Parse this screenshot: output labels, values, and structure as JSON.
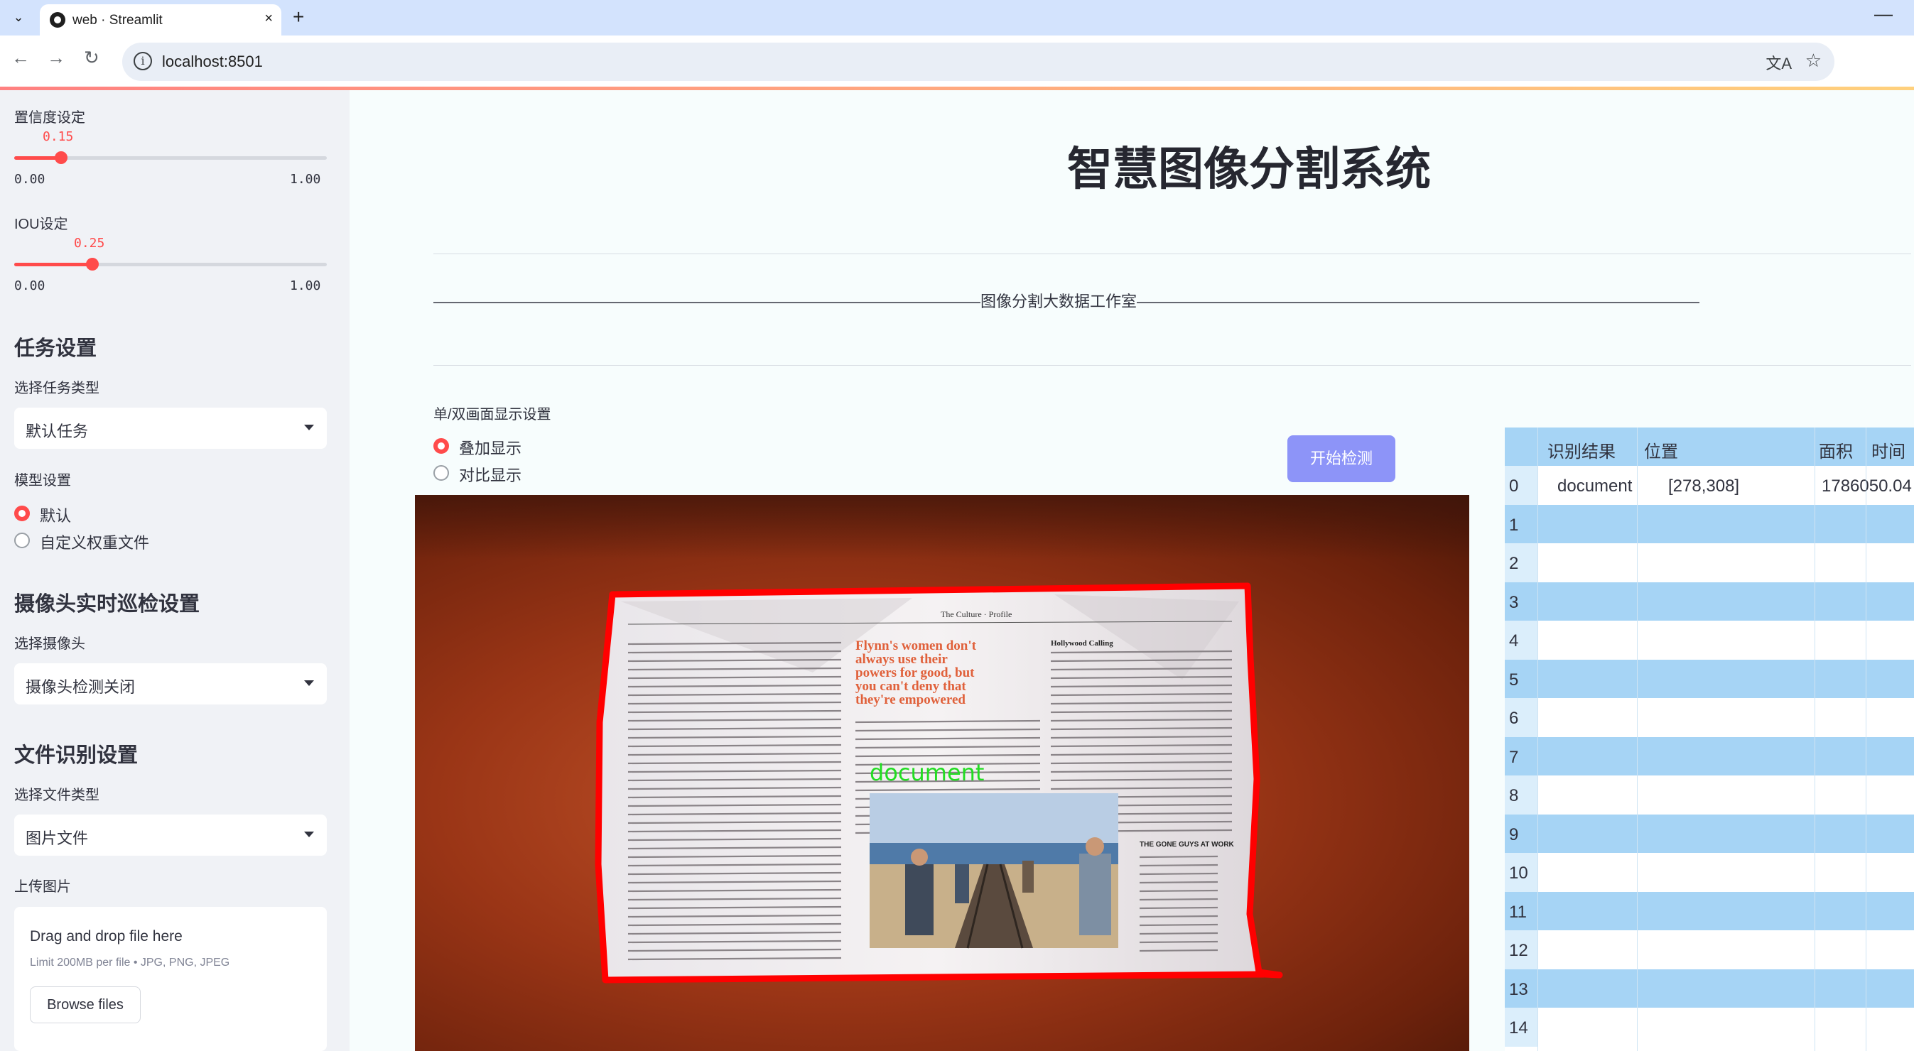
{
  "browser": {
    "tab_title": "web · Streamlit",
    "url": "localhost:8501",
    "new_tab": "+",
    "close": "×",
    "minimize": "—"
  },
  "sidebar": {
    "confidence": {
      "label": "置信度设定",
      "value": "0.15",
      "value_fraction": 0.15,
      "min": "0.00",
      "max": "1.00"
    },
    "iou": {
      "label": "IOU设定",
      "value": "0.25",
      "value_fraction": 0.25,
      "min": "0.00",
      "max": "1.00"
    },
    "task_section": {
      "heading": "任务设置",
      "select_label": "选择任务类型",
      "selected": "默认任务"
    },
    "model_section": {
      "label": "模型设置",
      "options": [
        "默认",
        "自定义权重文件"
      ],
      "selected_index": 0
    },
    "camera_section": {
      "heading": "摄像头实时巡检设置",
      "select_label": "选择摄像头",
      "selected": "摄像头检测关闭"
    },
    "file_section": {
      "heading": "文件识别设置",
      "select_label": "选择文件类型",
      "selected": "图片文件"
    },
    "upload": {
      "label": "上传图片",
      "drop_text": "Drag and drop file here",
      "limit_text": "Limit 200MB per file • JPG, PNG, JPEG",
      "browse_label": "Browse files"
    }
  },
  "main": {
    "title": "智慧图像分割系统",
    "subtitle": "———————————————————————————————————图像分割大数据工作室————————————————————————————————————",
    "display_label": "单/双画面显示设置",
    "display_options": [
      "叠加显示",
      "对比显示"
    ],
    "display_selected_index": 0,
    "start_button": "开始检测",
    "detection_label": "document"
  },
  "results_table": {
    "columns": [
      "识别结果",
      "位置",
      "面积",
      "时间"
    ],
    "rows": [
      {
        "index": "0",
        "result": "document",
        "position": "[278,308]",
        "area": "1786050.04"
      },
      {
        "index": "1"
      },
      {
        "index": "2"
      },
      {
        "index": "3"
      },
      {
        "index": "4"
      },
      {
        "index": "5"
      },
      {
        "index": "6"
      },
      {
        "index": "7"
      },
      {
        "index": "8"
      },
      {
        "index": "9"
      },
      {
        "index": "10"
      },
      {
        "index": "11"
      },
      {
        "index": "12"
      },
      {
        "index": "13"
      },
      {
        "index": "14"
      }
    ]
  },
  "newspaper": {
    "header": "The Culture · Profile",
    "headline": "Flynn's women don't always use their powers for good, but you can't deny that they're empowered",
    "side_heading": "Hollywood Calling",
    "box_heading": "THE GONE GUYS AT WORK"
  },
  "colors": {
    "accent": "#ff4b4b",
    "start_button": "#8d94f8",
    "table_header": "#a6d4f5",
    "mask_outline": "#ff0000",
    "detection_label": "#22dd22"
  }
}
